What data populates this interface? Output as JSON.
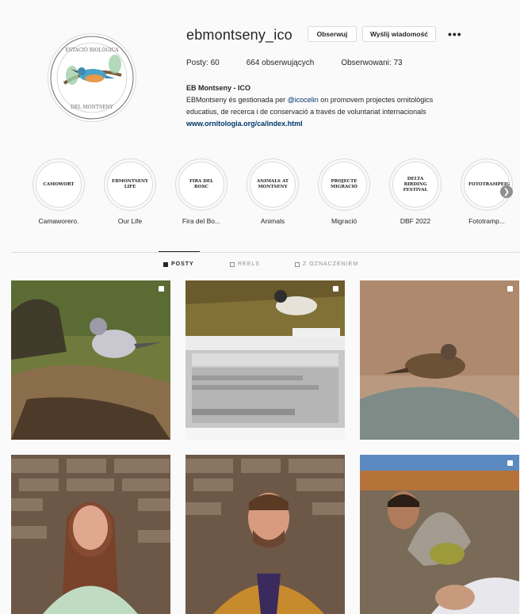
{
  "profile": {
    "username": "ebmontseny_ico",
    "follow_label": "Obserwuj",
    "message_label": "Wyślij wiadomość",
    "more_label": "•••",
    "stats": {
      "posts": "Posty: 60",
      "followers": "664 obserwujących",
      "following": "Obserwowani: 73"
    },
    "bio": {
      "name": "EB Montseny - ICO",
      "line1_pre": "EBMontseny és gestionada per ",
      "mention": "@icocelin",
      "line1_post": " on promovem projectes ornitològics",
      "line2": "educatius, de recerca i de conservació a través de voluntariat internacionals",
      "link": "www.ornitologia.org/ca/index.html"
    }
  },
  "highlights": [
    {
      "cover": "CAMOWORT",
      "label": "Camaworero."
    },
    {
      "cover": "EBMONTSENY LIFE",
      "label": "Our Life"
    },
    {
      "cover": "FIRA DEL BOSC",
      "label": "Fira del Bo..."
    },
    {
      "cover": "ANIMALS AT MONTSENY",
      "label": "Animals"
    },
    {
      "cover": "PROJECTE MIGRACIÓ",
      "label": "Migració"
    },
    {
      "cover": "DELTA BIRDING FESTIVAL",
      "label": "DBF 2022"
    },
    {
      "cover": "FOTOTRAMPEIG",
      "label": "Fototramp..."
    }
  ],
  "tabs": {
    "posts": "POSTY",
    "reels": "REELS",
    "tagged": "Z OZNACZENIEM"
  },
  "colors": {
    "background": "#fafafa",
    "link": "#00376b",
    "border": "#dbdbdb"
  }
}
